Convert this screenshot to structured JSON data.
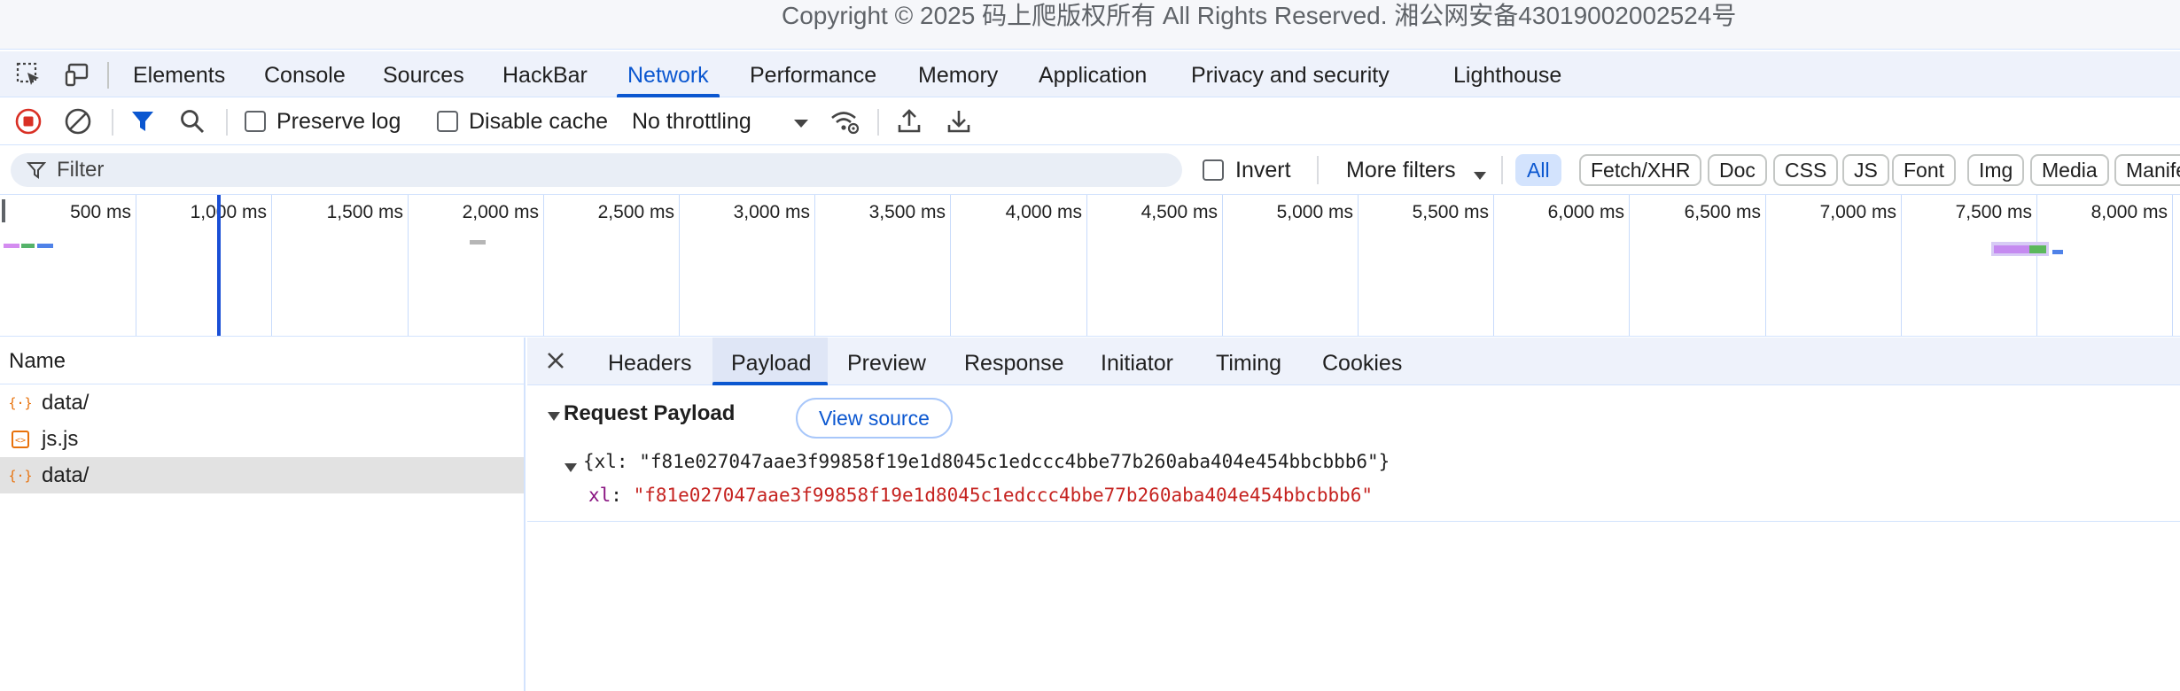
{
  "page": {
    "copyright": "Copyright © 2025 码上爬版权所有 All Rights Reserved. 湘公网安备43019002002524号"
  },
  "tabs": [
    "Elements",
    "Console",
    "Sources",
    "HackBar",
    "Network",
    "Performance",
    "Memory",
    "Application",
    "Privacy and security",
    "Lighthouse"
  ],
  "active_tab": "Network",
  "toolbar": {
    "preserve_log": "Preserve log",
    "disable_cache": "Disable cache",
    "throttling": "No throttling",
    "preserve_log_checked": false,
    "disable_cache_checked": false
  },
  "filter": {
    "placeholder": "Filter",
    "invert": "Invert",
    "more_filters": "More filters",
    "types": [
      "All",
      "Fetch/XHR",
      "Doc",
      "CSS",
      "JS",
      "Font",
      "Img",
      "Media",
      "Manifest"
    ],
    "active_type": "All"
  },
  "overview": {
    "ticks": [
      "500 ms",
      "1,000 ms",
      "1,500 ms",
      "2,000 ms",
      "2,500 ms",
      "3,000 ms",
      "3,500 ms",
      "4,000 ms",
      "4,500 ms",
      "5,000 ms",
      "5,500 ms",
      "6,000 ms",
      "6,500 ms",
      "7,000 ms",
      "7,500 ms",
      "8,000 ms"
    ]
  },
  "requests": {
    "header": "Name",
    "rows": [
      {
        "name": "data/",
        "type": "fetch",
        "selected": false
      },
      {
        "name": "js.js",
        "type": "script",
        "selected": false
      },
      {
        "name": "data/",
        "type": "fetch",
        "selected": true
      }
    ]
  },
  "detail": {
    "tabs": [
      "Headers",
      "Payload",
      "Preview",
      "Response",
      "Initiator",
      "Timing",
      "Cookies"
    ],
    "active_tab": "Payload",
    "section_title": "Request Payload",
    "view_source": "View source",
    "payload_summary": "{xl: \"f81e027047aae3f99858f19e1d8045c1edccc4bbe77b260aba404e454bbcbbb6\"}",
    "payload_key": "xl",
    "payload_value": "\"f81e027047aae3f99858f19e1d8045c1edccc4bbe77b260aba404e454bbcbbb6\""
  },
  "colors": {
    "accent": "#0b57d0",
    "record": "#d93025",
    "fetch_icon": "#e8710a",
    "string_value": "#c5221f",
    "key": "#881280"
  }
}
